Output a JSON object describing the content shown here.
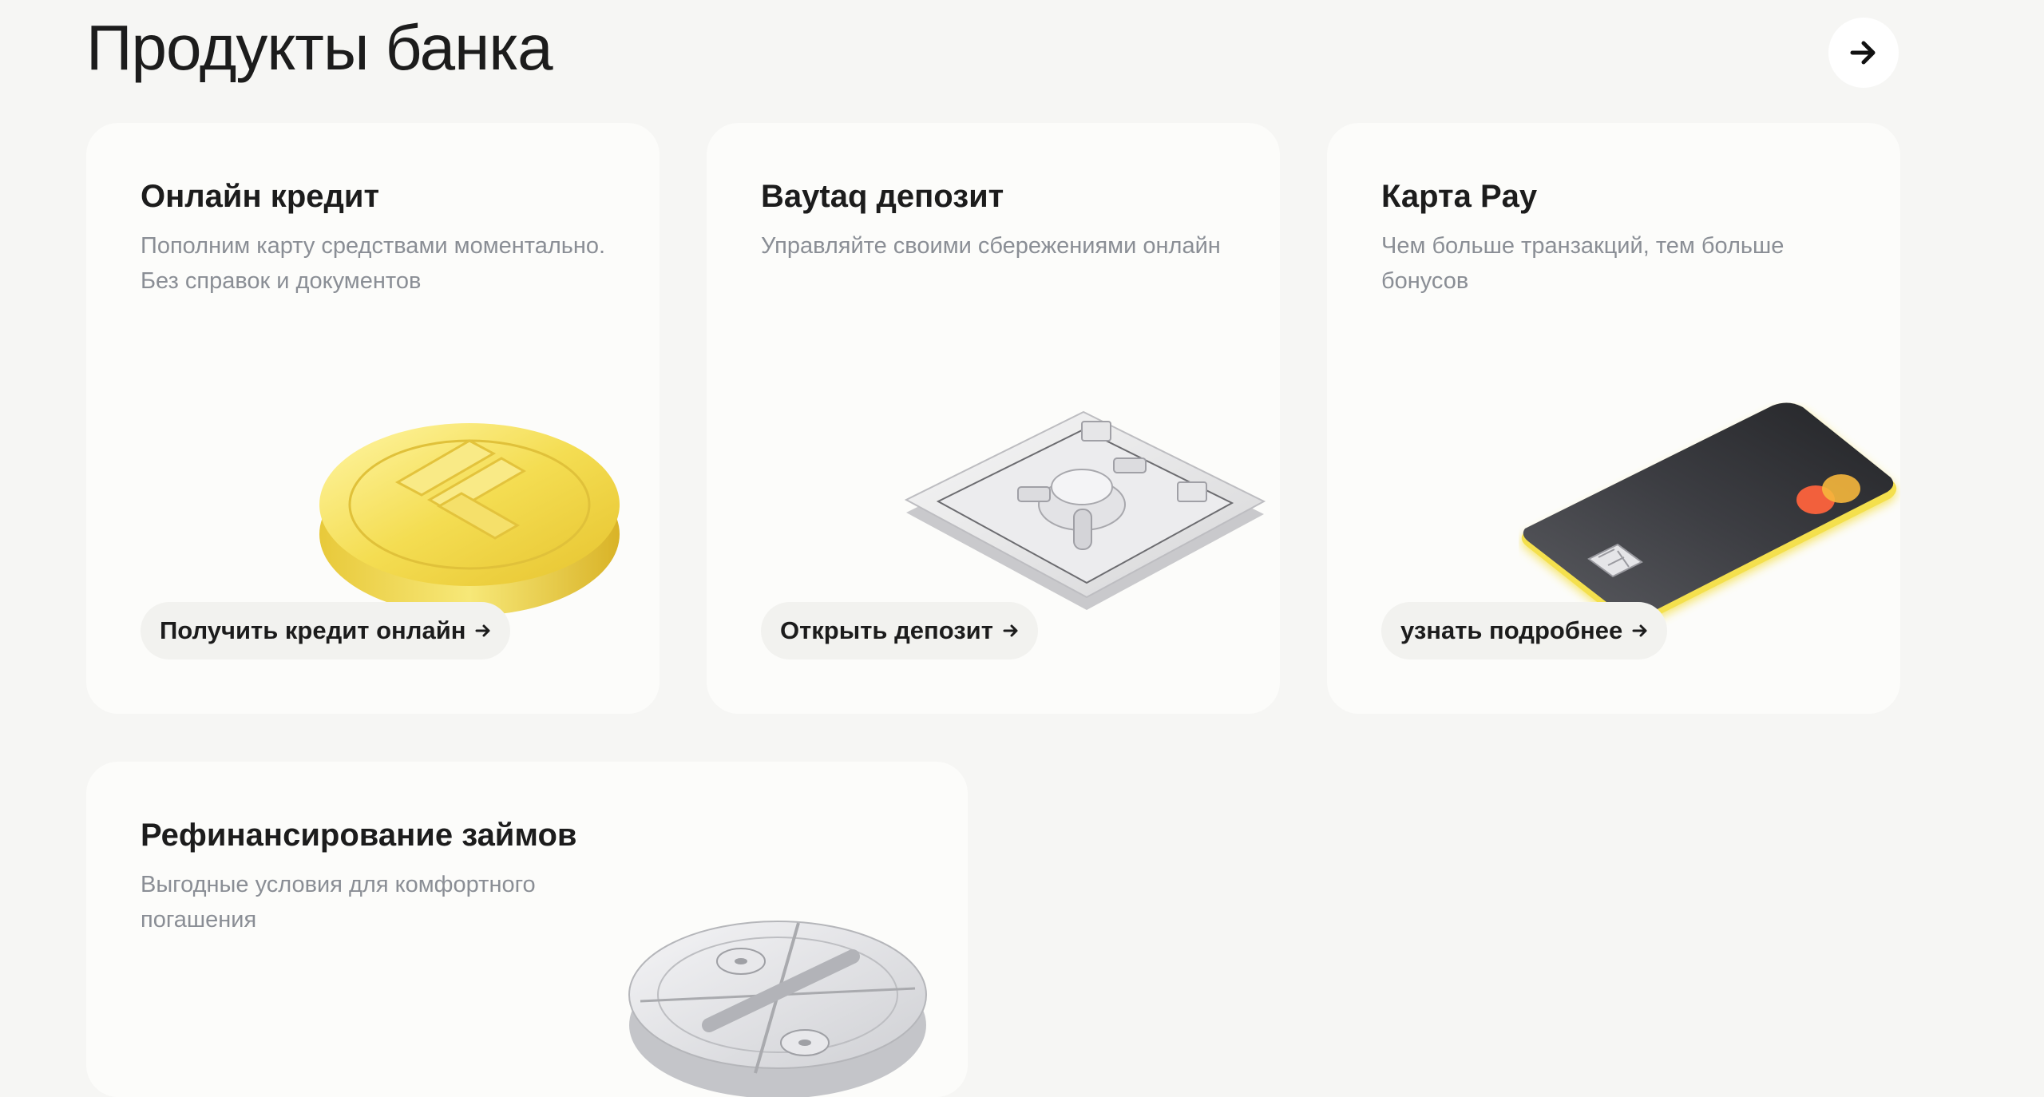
{
  "section": {
    "title": "Продукты банка",
    "all_products_icon": "arrow-right-icon"
  },
  "cards": [
    {
      "title": "Онлайн кредит",
      "description": "Пополним карту средствами моментально. Без справок и документов",
      "cta": "Получить кредит онлайн",
      "illustration": "gold-tenge-coin"
    },
    {
      "title": "Baytaq депозит",
      "description": "Управляйте своими сбережениями онлайн",
      "cta": "Открыть депозит",
      "illustration": "silver-safe"
    },
    {
      "title": "Карта Pay",
      "description": "Чем больше транзакций, тем больше бонусов",
      "cta": "узнать подробнее",
      "illustration": "black-bank-card"
    },
    {
      "title": "Рефинансирование займов",
      "description": "Выгодные условия для комфортного погашения",
      "illustration": "silver-percent-coin"
    }
  ],
  "colors": {
    "page_background": "#f6f6f4",
    "card_background": "#fcfcfa",
    "button_background": "#f2f2ef",
    "text": "#1c1c1c",
    "muted_text": "#8a8e95",
    "accent_yellow": "#f4e04d"
  }
}
